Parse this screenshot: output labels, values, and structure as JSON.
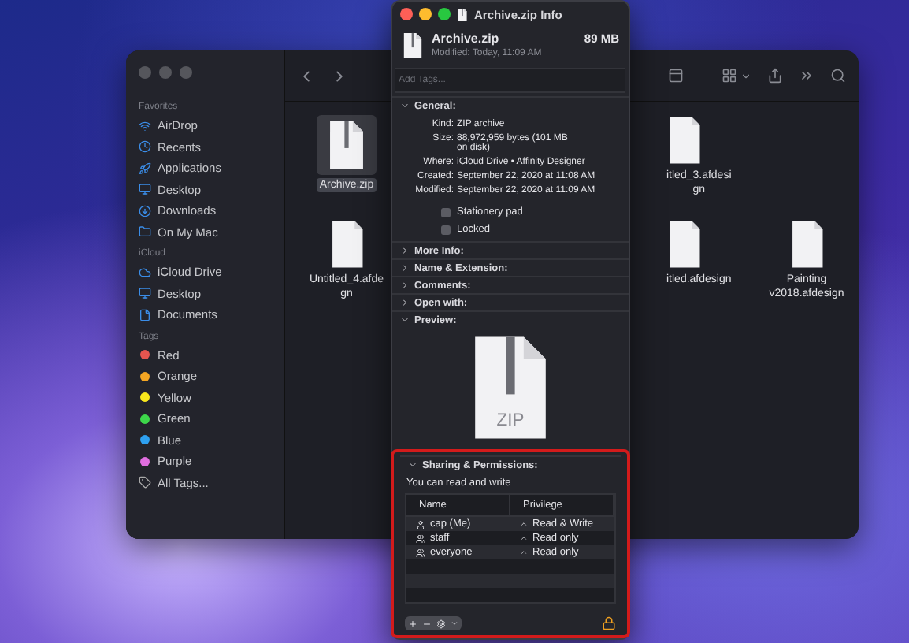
{
  "finder": {
    "sidebar": [
      {
        "heading": "Favorites",
        "items": [
          {
            "label": "AirDrop",
            "kind": "place"
          },
          {
            "label": "Recents",
            "kind": "place"
          },
          {
            "label": "Applications",
            "kind": "place"
          },
          {
            "label": "Desktop",
            "kind": "place"
          },
          {
            "label": "Downloads",
            "kind": "place"
          },
          {
            "label": "On My Mac",
            "kind": "place"
          }
        ]
      },
      {
        "heading": "iCloud",
        "items": [
          {
            "label": "iCloud Drive",
            "kind": "place"
          },
          {
            "label": "Desktop",
            "kind": "place"
          },
          {
            "label": "Documents",
            "kind": "place"
          }
        ]
      },
      {
        "heading": "Tags",
        "items": [
          {
            "label": "Red",
            "kind": "tag",
            "color": "#e5554f"
          },
          {
            "label": "Orange",
            "kind": "tag",
            "color": "#f5a623"
          },
          {
            "label": "Yellow",
            "kind": "tag",
            "color": "#f8e71c"
          },
          {
            "label": "Green",
            "kind": "tag",
            "color": "#3dd64a"
          },
          {
            "label": "Blue",
            "kind": "tag",
            "color": "#2ea0f0"
          },
          {
            "label": "Purple",
            "kind": "tag",
            "color": "#e06ee0"
          },
          {
            "label": "All Tags...",
            "kind": "all"
          }
        ]
      }
    ],
    "files": [
      {
        "lines": [
          "Archive.zip"
        ],
        "kind": "zip",
        "selected": true
      },
      {
        "lines": [
          "itled_3.afdesi",
          "gn"
        ],
        "kind": "doc",
        "selected": false
      },
      {
        "lines": [
          "Untitled_4.afde",
          "gn"
        ],
        "kind": "doc",
        "selected": false
      },
      {
        "lines": [
          "itled.afdesign"
        ],
        "kind": "doc",
        "selected": false
      },
      {
        "lines": [
          "Painting",
          "v2018.afdesign"
        ],
        "kind": "doc",
        "selected": false
      }
    ]
  },
  "info": {
    "title": "Archive.zip Info",
    "name": "Archive.zip",
    "size": "89 MB",
    "modified": "Modified: Today, 11:09 AM",
    "tags_placeholder": "Add Tags...",
    "sections": [
      {
        "title": "General:",
        "kind": "general",
        "expanded": true
      },
      {
        "title": "More Info:",
        "kind": "plain",
        "expanded": false
      },
      {
        "title": "Name & Extension:",
        "kind": "plain",
        "expanded": false
      },
      {
        "title": "Comments:",
        "kind": "plain",
        "expanded": false
      },
      {
        "title": "Open with:",
        "kind": "plain",
        "expanded": false
      },
      {
        "title": "Preview:",
        "kind": "preview",
        "expanded": true
      },
      {
        "title": "Sharing & Permissions:",
        "kind": "sharing",
        "expanded": true
      }
    ],
    "general": [
      {
        "key": "Kind:",
        "value": [
          "ZIP archive"
        ]
      },
      {
        "key": "Size:",
        "value": [
          "88,972,959 bytes (101 MB",
          "on disk)"
        ]
      },
      {
        "key": "Where:",
        "value": [
          "iCloud Drive • Affinity Designer"
        ]
      },
      {
        "key": "Created:",
        "value": [
          "September 22, 2020 at 11:08 AM"
        ]
      },
      {
        "key": "Modified:",
        "value": [
          "September 22, 2020 at 11:09 AM"
        ]
      }
    ],
    "checkboxes": [
      {
        "label": "Stationery pad",
        "checked": false
      },
      {
        "label": "Locked",
        "checked": false
      }
    ],
    "preview_label": "ZIP",
    "sharing_note": "You can read and write",
    "columns": [
      "Name",
      "Privilege"
    ],
    "permissions": [
      {
        "name": "cap (Me)",
        "privilege": "Read & Write",
        "kind": "user"
      },
      {
        "name": "staff",
        "privilege": "Read only",
        "kind": "group"
      },
      {
        "name": "everyone",
        "privilege": "Read only",
        "kind": "everyone"
      }
    ],
    "highlighted": true
  }
}
